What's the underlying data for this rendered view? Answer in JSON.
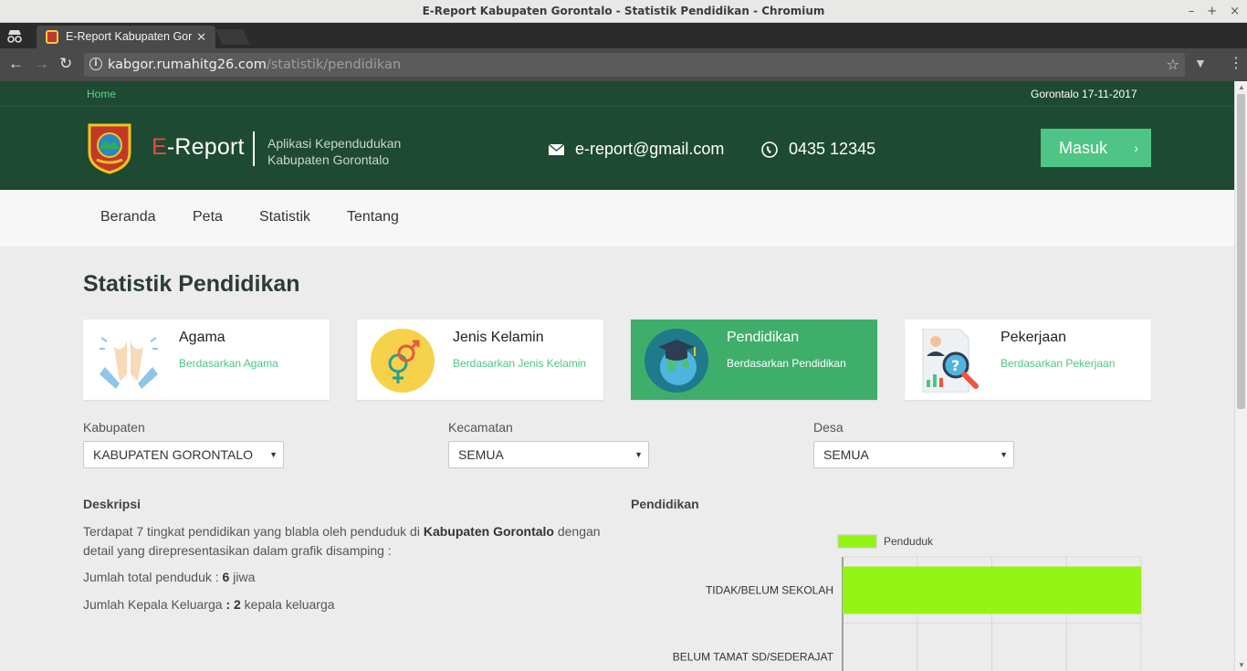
{
  "window": {
    "title": "E-Report Kabupaten Gorontalo - Statistik Pendidikan - Chromium",
    "controls": [
      "–",
      "+",
      "×"
    ]
  },
  "browser": {
    "tab_title": "E-Report Kabupaten Gor",
    "url_host": "kabgor.rumahitg26.com",
    "url_path": "/statistik/pendidikan"
  },
  "topbar": {
    "home": "Home",
    "date": "Gorontalo 17-11-2017"
  },
  "header": {
    "brand_e": "E",
    "brand_rest": "-Report",
    "tagline_line1": "Aplikasi Kependudukan",
    "tagline_line2": "Kabupaten Gorontalo",
    "email": "e-report@gmail.com",
    "phone": "0435 12345",
    "login_label": "Masuk"
  },
  "nav": {
    "items": [
      "Beranda",
      "Peta",
      "Statistik",
      "Tentang"
    ]
  },
  "page": {
    "title": "Statistik Pendidikan"
  },
  "cards": [
    {
      "title": "Agama",
      "subtitle": "Berdasarkan Agama",
      "icon": "praying-hands-icon",
      "active": false
    },
    {
      "title": "Jenis Kelamin",
      "subtitle": "Berdasarkan Jenis Kelamin",
      "icon": "gender-symbols-icon",
      "active": false
    },
    {
      "title": "Pendidikan",
      "subtitle": "Berdasarkan Pendidikan",
      "icon": "graduation-globe-icon",
      "active": true
    },
    {
      "title": "Pekerjaan",
      "subtitle": "Berdasarkan Pekerjaan",
      "icon": "job-search-icon",
      "active": false
    }
  ],
  "filters": [
    {
      "label": "Kabupaten",
      "value": "KABUPATEN GORONTALO"
    },
    {
      "label": "Kecamatan",
      "value": "SEMUA"
    },
    {
      "label": "Desa",
      "value": "SEMUA"
    }
  ],
  "deskripsi": {
    "heading": "Deskripsi",
    "text_pre": "Terdapat 7 tingkat pendidikan yang blabla oleh penduduk di ",
    "text_bold": "Kabupaten Gorontalo",
    "text_post": " dengan detail yang direpresentasikan dalam grafik disamping :",
    "total_label": "Jumlah total penduduk : ",
    "total_value": "6",
    "total_unit": " jiwa",
    "kk_label": "Jumlah Kepala Keluarga ",
    "kk_sep": ": 2",
    "kk_unit": " kepala keluarga"
  },
  "chart_heading": "Pendidikan",
  "chart_data": {
    "type": "bar",
    "orientation": "horizontal",
    "categories": [
      "TIDAK/BELUM SEKOLAH",
      "BELUM TAMAT SD/SEDERAJAT"
    ],
    "series": [
      {
        "name": "Penduduk",
        "values": [
          6,
          0
        ]
      }
    ],
    "xlim": [
      0,
      6
    ],
    "grid": true,
    "legend": "top",
    "color": "#94f413"
  }
}
